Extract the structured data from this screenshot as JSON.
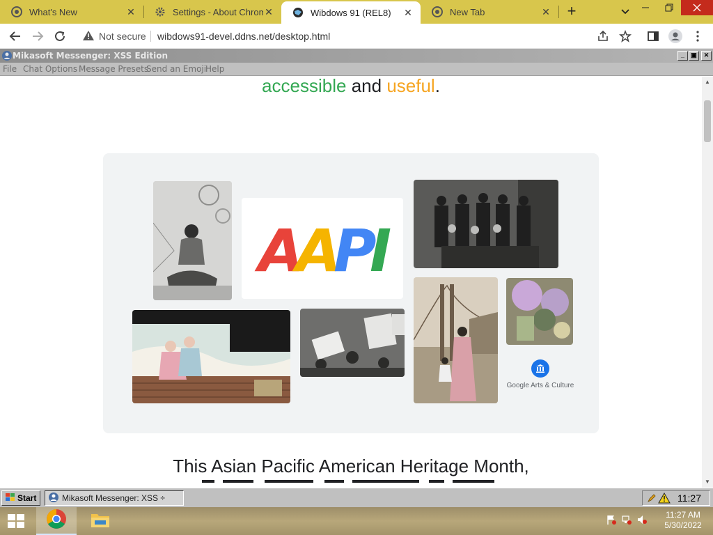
{
  "tabs": [
    {
      "label": "What's New",
      "icon": "chrome-icon",
      "active": false
    },
    {
      "label": "Settings - About Chrome",
      "icon": "gear-icon",
      "active": false
    },
    {
      "label": "Wibdows 91 (REL8)",
      "icon": "globe-icon",
      "active": true
    },
    {
      "label": "New Tab",
      "icon": "chrome-icon",
      "active": false
    }
  ],
  "toolbar": {
    "security_label": "Not secure",
    "url": "wibdows91-devel.ddns.net/desktop.html"
  },
  "messenger": {
    "title": "Mikasoft Messenger: XSS Edition",
    "menu": [
      "File",
      "Chat Options",
      "Message Presets",
      "Send an Emoji",
      "Help"
    ]
  },
  "page": {
    "headline_word1": "accessible",
    "headline_and": "and",
    "headline_word2": "useful",
    "headline_end": ".",
    "aapi_title": "AAPI",
    "gac_label": "Google Arts & Culture",
    "bottom_text": "This Asian Pacific American Heritage Month,"
  },
  "w98taskbar": {
    "start_label": "Start",
    "task_label": "Mikasoft Messenger: XSS ÷",
    "clock": "11:27"
  },
  "wintaskbar": {
    "time": "11:27 AM",
    "date": "5/30/2022"
  },
  "colors": {
    "tabstrip": "#d8c64c",
    "accent_green": "#34a853",
    "accent_yellow": "#f6a522",
    "close_red": "#c42b1c"
  }
}
